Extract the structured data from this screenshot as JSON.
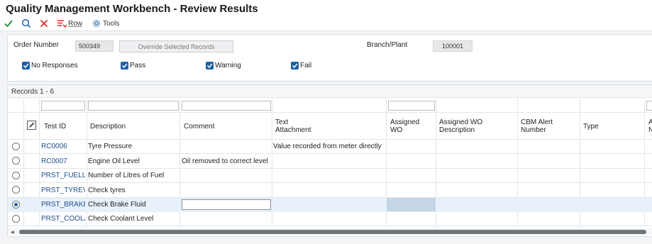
{
  "window": {
    "title": "Quality Management Workbench - Review Results"
  },
  "toolbar": {
    "ok_icon": "checkmark-icon",
    "find_icon": "search-icon",
    "close_icon": "close-icon",
    "row_label": "Row",
    "tools_label": "Tools"
  },
  "header": {
    "order_number_label": "Order Number",
    "order_number_value": "500349",
    "override_button": "Override Selected Records",
    "branch_plant_label": "Branch/Plant",
    "branch_plant_value": "100001",
    "filters": {
      "no_responses": "No Responses",
      "pass": "Pass",
      "warning": "Warning",
      "fail": "Fail"
    }
  },
  "grid": {
    "records_label": "Records 1 - 6",
    "columns": {
      "test_id": "Test ID",
      "description": "Description",
      "comment": "Comment",
      "text_attachment_1": "Text",
      "text_attachment_2": "Attachment",
      "assigned_wo_1": "Assigned",
      "assigned_wo_2": "WO",
      "assigned_wo_desc_1": "Assigned WO",
      "assigned_wo_desc_2": "Description",
      "cbm_alert_1": "CBM Alert",
      "cbm_alert_2": "Number",
      "type": "Type",
      "next_1": "A",
      "next_2": "N"
    },
    "rows": [
      {
        "test_id": "RC0006",
        "description": "Tyre Pressure",
        "comment": "",
        "text_attachment": "Value recorded from meter directly",
        "selected": false
      },
      {
        "test_id": "RC0007",
        "description": "Engine Oil Level",
        "comment": "Oil removed to correct level",
        "text_attachment": "",
        "selected": false
      },
      {
        "test_id": "PRST_FUELLIT",
        "description": "Number of Litres of Fuel",
        "comment": "",
        "text_attachment": "",
        "selected": false
      },
      {
        "test_id": "PRST_TYREVIS",
        "description": "Check tyres",
        "comment": "",
        "text_attachment": "",
        "selected": false
      },
      {
        "test_id": "PRST_BRAKEFI",
        "description": "Check Brake Fluid",
        "comment": "",
        "text_attachment": "",
        "selected": true
      },
      {
        "test_id": "PRST_COOLAN",
        "description": "Check Coolant Level",
        "comment": "",
        "text_attachment": "",
        "selected": false
      }
    ]
  },
  "colors": {
    "accent": "#1f5fa6",
    "link": "#1e4e8c",
    "selected_row": "#e8f1fa"
  }
}
